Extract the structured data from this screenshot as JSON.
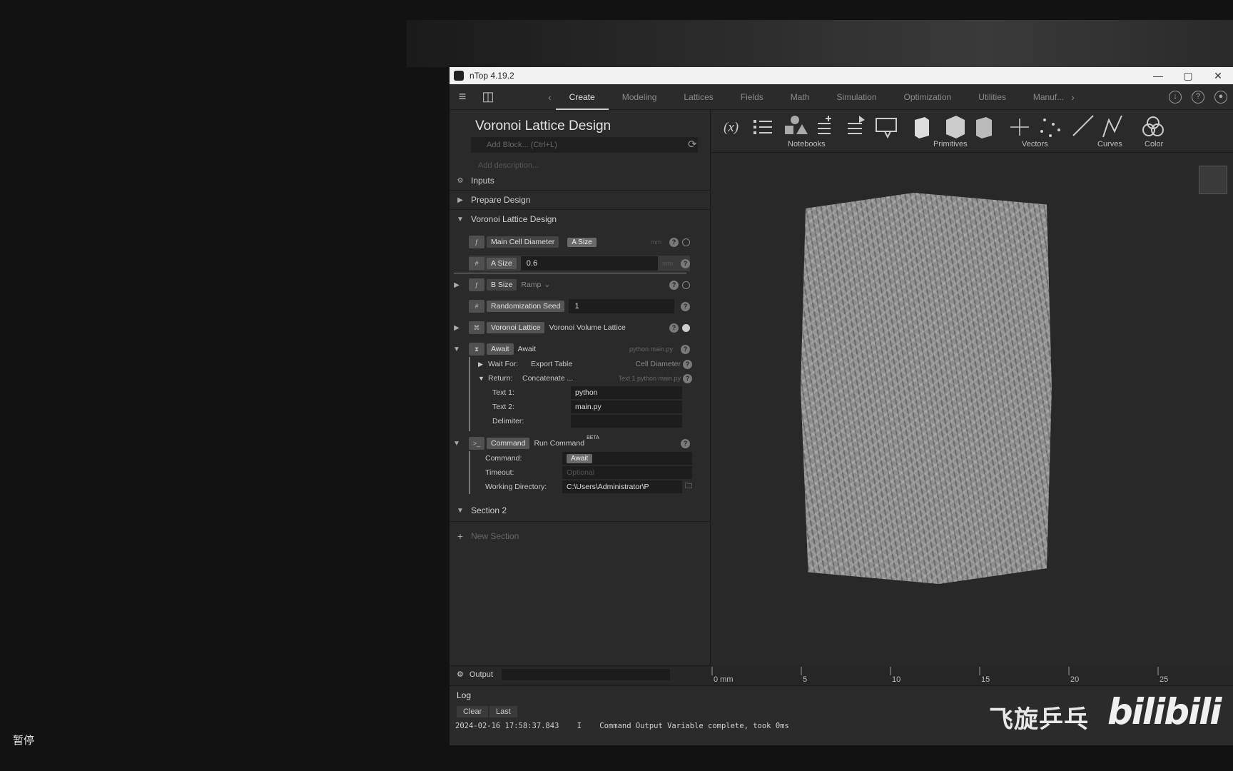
{
  "window": {
    "title": "nTop 4.19.2",
    "controls": [
      "—",
      "▢",
      "✕"
    ]
  },
  "menubar": {
    "tabs": [
      "Create",
      "Modeling",
      "Lattices",
      "Fields",
      "Math",
      "Simulation",
      "Optimization",
      "Utilities",
      "Manuf..."
    ],
    "active_tab": "Create"
  },
  "notebook": {
    "title": "Voronoi Lattice Design",
    "add_block_placeholder": "Add Block... (Ctrl+L)",
    "add_description": "Add description...",
    "sections": {
      "inputs": "Inputs",
      "prepare": "Prepare Design",
      "voronoi": "Voronoi Lattice Design",
      "section2": "Section 2",
      "new_section": "New Section"
    },
    "blocks": {
      "main_cell": {
        "label": "Main Cell Diameter",
        "tag": "A Size",
        "unit": "mm"
      },
      "a_size": {
        "label": "A Size",
        "value": "0.6",
        "unit": "mm"
      },
      "b_size": {
        "label": "B Size",
        "mode": "Ramp"
      },
      "seed": {
        "label": "Randomization Seed",
        "value": "1"
      },
      "voronoi": {
        "label": "Voronoi Lattice",
        "type": "Voronoi Volume Lattice"
      },
      "await": {
        "label": "Await",
        "type": "Await",
        "hint": "python main.py",
        "wait_for": "Wait For:",
        "wait_value": "Export Table",
        "wait_hint": "Cell Diameter",
        "return_label": "Return:",
        "return_value": "Concatenate ...",
        "return_hint": "Text 1 python main.py",
        "text1_label": "Text 1:",
        "text1": "python",
        "text2_label": "Text 2:",
        "text2": "main.py",
        "delim_label": "Delimiter:"
      },
      "command": {
        "label": "Command",
        "type": "Run Command",
        "badge": "BETA",
        "cmd_label": "Command:",
        "cmd_tag": "Await",
        "timeout_label": "Timeout:",
        "timeout_placeholder": "Optional",
        "workdir_label": "Working Directory:",
        "workdir": "C:\\Users\\Administrator\\P"
      }
    },
    "output_label": "Output"
  },
  "ribbon": {
    "groups": [
      "Notebooks",
      "Primitives",
      "Vectors",
      "Curves",
      "Color"
    ]
  },
  "ruler": {
    "labels": [
      "0 mm",
      "5",
      "10",
      "15",
      "20",
      "25"
    ]
  },
  "log": {
    "tab": "Log",
    "clear": "Clear",
    "last": "Last",
    "line": "2024-02-16 17:58:37.843    I    Command Output Variable complete, took 0ms"
  },
  "overlay": {
    "pause": "暂停",
    "watermark_cn": "飞旋乒乓",
    "watermark_brand": "bilibili"
  }
}
